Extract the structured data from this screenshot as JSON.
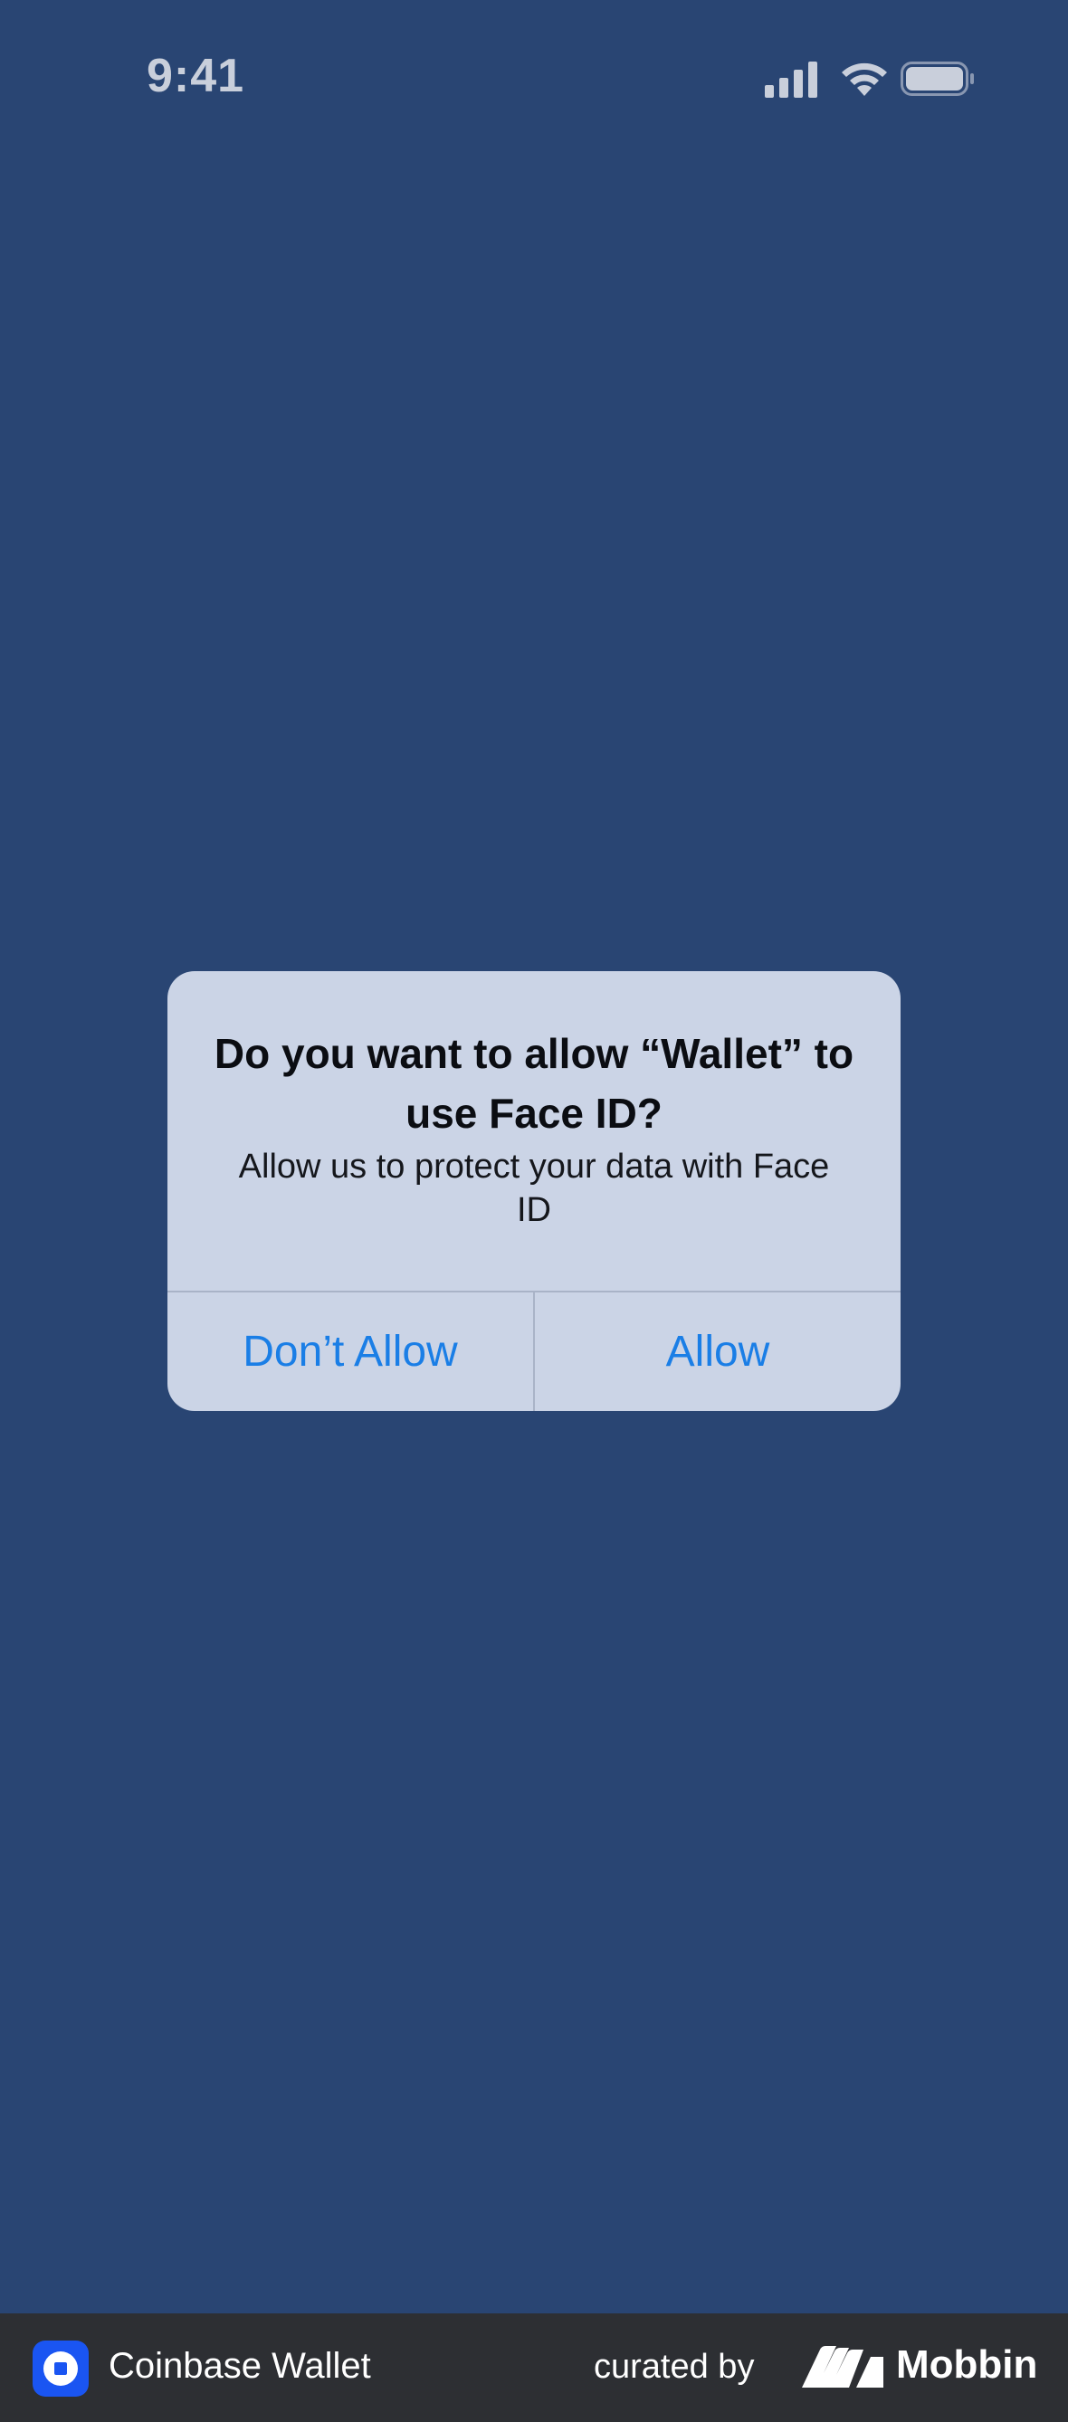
{
  "status_bar": {
    "time": "9:41",
    "icons": [
      "signal-icon",
      "wifi-icon",
      "battery-icon"
    ]
  },
  "alert": {
    "title": "Do you want to allow “Wallet” to use Face ID?",
    "message": "Allow us to protect your data with Face ID",
    "buttons": {
      "dont_allow": "Don’t Allow",
      "allow": "Allow"
    }
  },
  "footer": {
    "app_name": "Coinbase Wallet",
    "curated_by": "curated by",
    "brand": "Mobbin"
  },
  "colors": {
    "background": "#294573",
    "alert_background": "#cbd4e6",
    "button_text": "#1a7ee6",
    "footer_background": "#2d2f33",
    "coinbase_blue": "#1a55f2"
  }
}
